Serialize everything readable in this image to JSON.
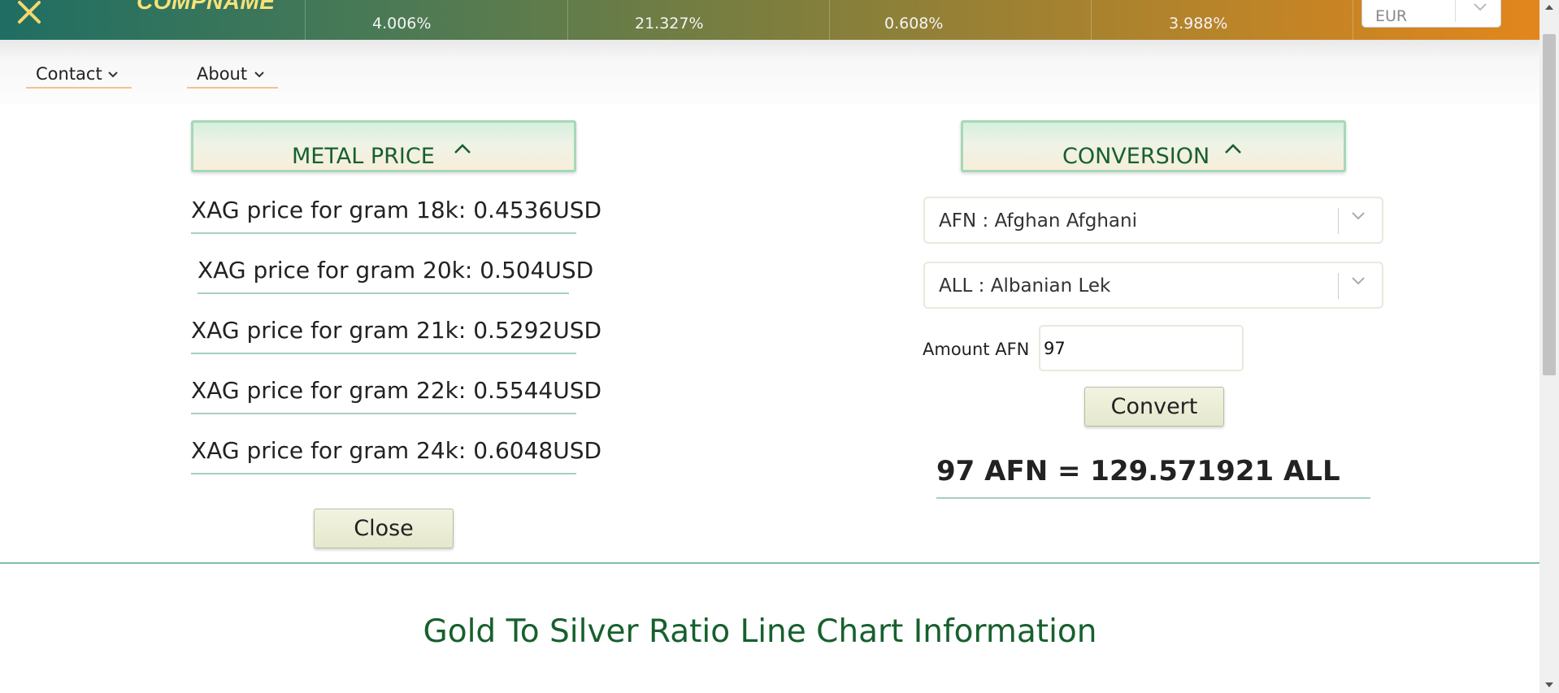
{
  "brand": {
    "logo_text": "COMPNAME"
  },
  "rates": [
    "4.006%",
    "21.327%",
    "0.608%",
    "3.988%"
  ],
  "currency_select": {
    "value": "EUR"
  },
  "nav": {
    "items": [
      {
        "label": "Contact"
      },
      {
        "label": "About"
      }
    ]
  },
  "metal_price": {
    "title": "METAL PRICE",
    "rows": [
      "XAG price for gram 18k: 0.4536USD",
      "XAG price for gram 20k: 0.504USD",
      "XAG price for gram 21k: 0.5292USD",
      "XAG price for gram 22k: 0.5544USD",
      "XAG price for gram 24k: 0.6048USD"
    ],
    "close_label": "Close"
  },
  "conversion": {
    "title": "CONVERSION",
    "from_currency": "AFN : Afghan Afghani",
    "to_currency": "ALL : Albanian Lek",
    "amount_label": "Amount AFN",
    "amount_value": "97",
    "convert_label": "Convert",
    "result": "97 AFN = 129.571921 ALL"
  },
  "chart_section": {
    "title": "Gold To Silver Ratio Line Chart Information"
  },
  "colors": {
    "accent_green": "#17602e",
    "banner_start": "#1f6e63",
    "banner_end": "#e2861c",
    "logo": "#f5e27a"
  }
}
